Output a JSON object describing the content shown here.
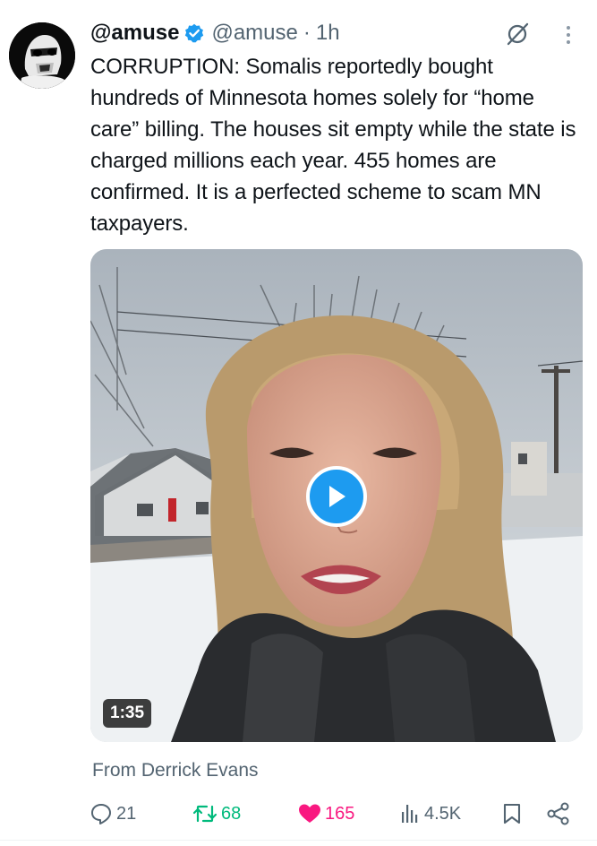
{
  "tweet": {
    "display_name": "@amuse",
    "handle": "@amuse",
    "separator": "·",
    "time": "1h",
    "text": "CORRUPTION: Somalis reportedly bought hundreds of Minnesota homes solely for “home care” billing. The houses sit empty while the state is charged millions each year. 455 homes are confirmed. It is a perfected scheme to scam MN taxpayers.",
    "media": {
      "duration": "1:35"
    },
    "source": "From Derrick Evans"
  },
  "actions": {
    "replies": "21",
    "reposts": "68",
    "likes": "165",
    "views": "4.5K"
  },
  "icons": {
    "verified": "verified-badge-icon",
    "grok": "grok-icon",
    "more": "more-icon",
    "reply": "reply-icon",
    "repost": "repost-icon",
    "like": "heart-icon",
    "views": "views-icon",
    "bookmark": "bookmark-icon",
    "share": "share-icon"
  },
  "colors": {
    "accent": "#1d9bf0",
    "text": "#0f1419",
    "muted": "#536471",
    "repost": "#00ba7c",
    "like": "#f91880"
  }
}
